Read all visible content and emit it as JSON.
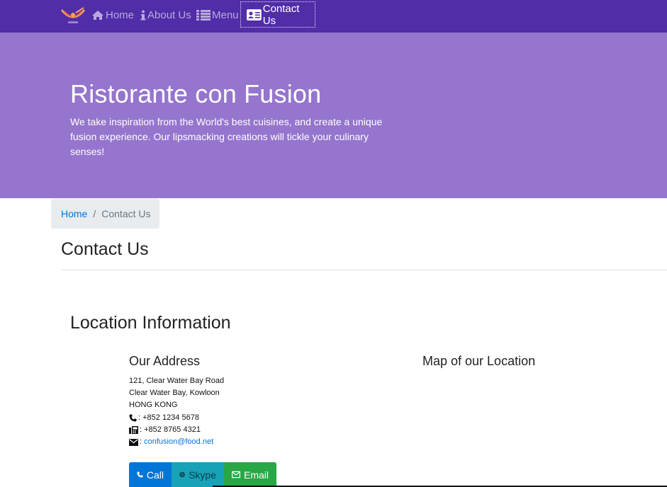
{
  "navbar": {
    "brand_icon": "restaurant-logo",
    "items": [
      {
        "label": "Home",
        "icon": "home-icon"
      },
      {
        "label": "About Us",
        "icon": "info-icon"
      },
      {
        "label": "Menu",
        "icon": "list-icon"
      },
      {
        "label": "Contact Us",
        "icon": "address-card-icon"
      }
    ],
    "color": "#512da8"
  },
  "jumbotron": {
    "title": "Ristorante con Fusion",
    "text": "We take inspiration from the World's best cuisines, and create a unique fusion experience. Our lipsmacking creations will tickle your culinary senses!",
    "color": "#9575cd"
  },
  "breadcrumb": {
    "home": "Home",
    "separator": "/",
    "current": "Contact Us"
  },
  "page": {
    "title": "Contact Us",
    "section_title": "Location Information",
    "address_title": "Our Address",
    "map_title": "Map of our Location"
  },
  "address": {
    "line1": "121, Clear Water Bay Road",
    "line2": "Clear Water Bay, Kowloon",
    "line3": "HONG KONG",
    "phone": ": +852 1234 5678",
    "fax": ": +852 8765 4321",
    "email_prefix": ":",
    "email": "confusion@food.net"
  },
  "buttons": {
    "call": "Call",
    "skype": "Skype",
    "email": "Email"
  }
}
